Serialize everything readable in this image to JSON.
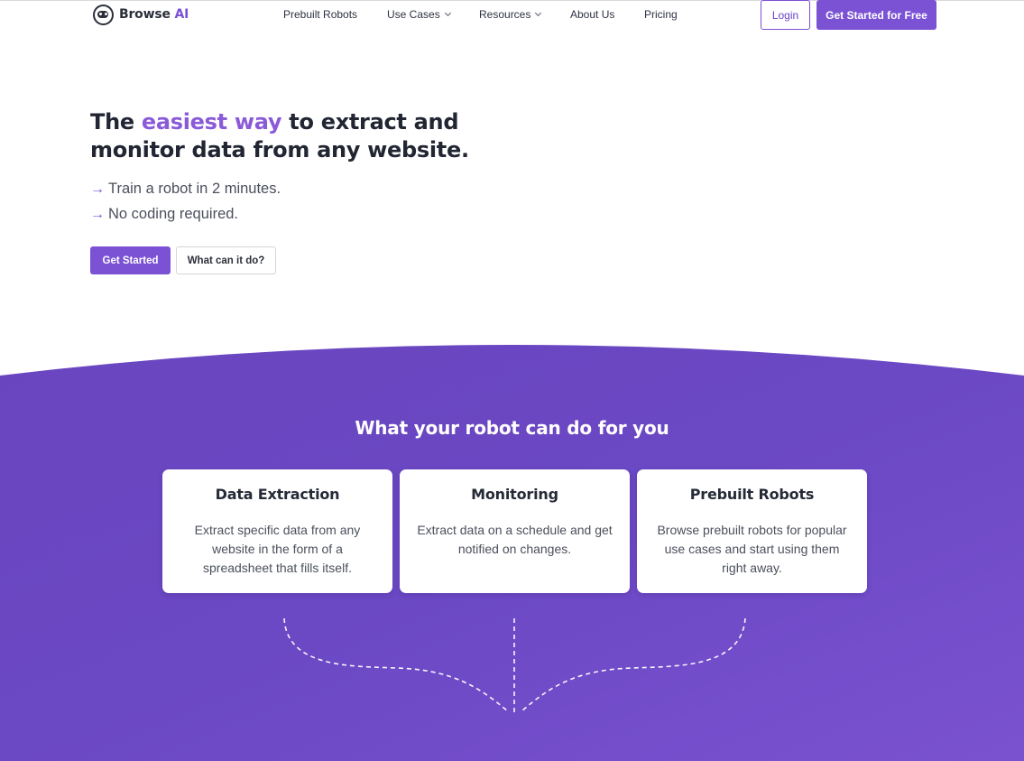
{
  "header": {
    "logo": {
      "name": "Browse",
      "accent": "AI",
      "icon": "robot-head-icon"
    },
    "nav": [
      {
        "label": "Prebuilt Robots",
        "dropdown": false
      },
      {
        "label": "Use Cases",
        "dropdown": true
      },
      {
        "label": "Resources",
        "dropdown": true
      },
      {
        "label": "About Us",
        "dropdown": false
      },
      {
        "label": "Pricing",
        "dropdown": false
      }
    ],
    "login_label": "Login",
    "cta_label": "Get Started for Free"
  },
  "hero": {
    "title_pre": "The ",
    "title_highlight": "easiest way",
    "title_post": " to extract and monitor data from any website.",
    "bullets": [
      {
        "arrow": "→",
        "text": "Train a robot in 2 minutes."
      },
      {
        "arrow": "→",
        "text": "No coding required."
      }
    ],
    "primary_button": "Get Started",
    "secondary_button": "What can it do?"
  },
  "features": {
    "title": "What your robot can do for you",
    "cards": [
      {
        "title": "Data Extraction",
        "text": "Extract specific data from any website in the form of a spreadsheet that fills itself."
      },
      {
        "title": "Monitoring",
        "text": "Extract data on a schedule and get notified on changes."
      },
      {
        "title": "Prebuilt Robots",
        "text": "Browse prebuilt robots for popular use cases and start using them right away."
      }
    ]
  },
  "colors": {
    "accent": "#7b52d4",
    "highlight": "#8a5ad9",
    "section_bg_start": "#6b47c0",
    "section_bg_end": "#7a51d0",
    "text_dark": "#222633"
  }
}
